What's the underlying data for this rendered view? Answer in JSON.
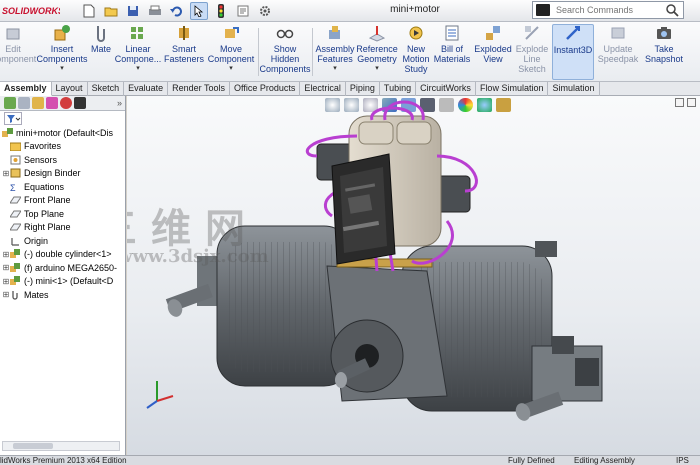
{
  "app": {
    "logo_text": "SOLIDWORKS",
    "document_title": "mini+motor"
  },
  "search": {
    "placeholder": "Search Commands"
  },
  "quick_access": [
    {
      "icon": "new-document-icon"
    },
    {
      "icon": "open-folder-icon"
    },
    {
      "icon": "save-icon"
    },
    {
      "icon": "print-icon"
    },
    {
      "icon": "undo-icon"
    },
    {
      "icon": "select-pointer-icon"
    },
    {
      "icon": "traffic-light-rebuild-icon"
    },
    {
      "icon": "file-properties-icon"
    },
    {
      "icon": "options-gear-icon"
    }
  ],
  "ribbon": {
    "edit_component": "Edit Component",
    "insert_components": "Insert Components",
    "mate": "Mate",
    "linear_component": "Linear Compone...",
    "smart_fasteners": "Smart Fasteners",
    "move_component": "Move Component",
    "show_hidden_components": "Show Hidden Components",
    "assembly_features": "Assembly Features",
    "reference_geometry": "Reference Geometry",
    "new_motion_study": "New Motion Study",
    "bill_of_materials": "Bill of Materials",
    "exploded_view": "Exploded View",
    "explode_line_sketch": "Explode Line Sketch",
    "instant3d": "Instant3D",
    "update_speedpak": "Update Speedpak",
    "take_snapshot": "Take Snapshot"
  },
  "tabs": [
    "Assembly",
    "Layout",
    "Sketch",
    "Evaluate",
    "Render Tools",
    "Office Products",
    "Electrical",
    "Piping",
    "Tubing",
    "CircuitWorks",
    "Flow Simulation",
    "Simulation"
  ],
  "active_tab": "Assembly",
  "tree": {
    "root": "mini+motor  (Default<Dis",
    "items": [
      {
        "label": "Favorites",
        "icon": "folder-icon",
        "expandable": false
      },
      {
        "label": "Sensors",
        "icon": "sensor-icon",
        "expandable": false
      },
      {
        "label": "Design Binder",
        "icon": "design-binder-icon",
        "expandable": true
      },
      {
        "label": "Equations",
        "icon": "equations-icon",
        "expandable": false
      },
      {
        "label": "Front Plane",
        "icon": "plane-icon",
        "expandable": false
      },
      {
        "label": "Top Plane",
        "icon": "plane-icon",
        "expandable": false
      },
      {
        "label": "Right Plane",
        "icon": "plane-icon",
        "expandable": false
      },
      {
        "label": "Origin",
        "icon": "origin-icon",
        "expandable": false
      },
      {
        "label": "(-) double cylinder<1>",
        "icon": "part-icon",
        "expandable": true
      },
      {
        "label": "(f) arduino MEGA2650-",
        "icon": "part-icon",
        "expandable": true
      },
      {
        "label": "(-) mini<1> (Default<D",
        "icon": "part-icon",
        "expandable": true
      },
      {
        "label": "Mates",
        "icon": "mates-icon",
        "expandable": true
      }
    ]
  },
  "watermark": {
    "line1": "三维网",
    "line2": "www.3dsjx.com"
  },
  "status": {
    "edition": "lidWorks Premium 2013 x64 Edition",
    "definition": "Fully Defined",
    "mode": "Editing Assembly",
    "units": "IPS"
  },
  "colors": {
    "accent": "#1a3a8a",
    "tube": "#b93fd1",
    "engine": "#6e7378",
    "board": "#2a2a2a"
  }
}
